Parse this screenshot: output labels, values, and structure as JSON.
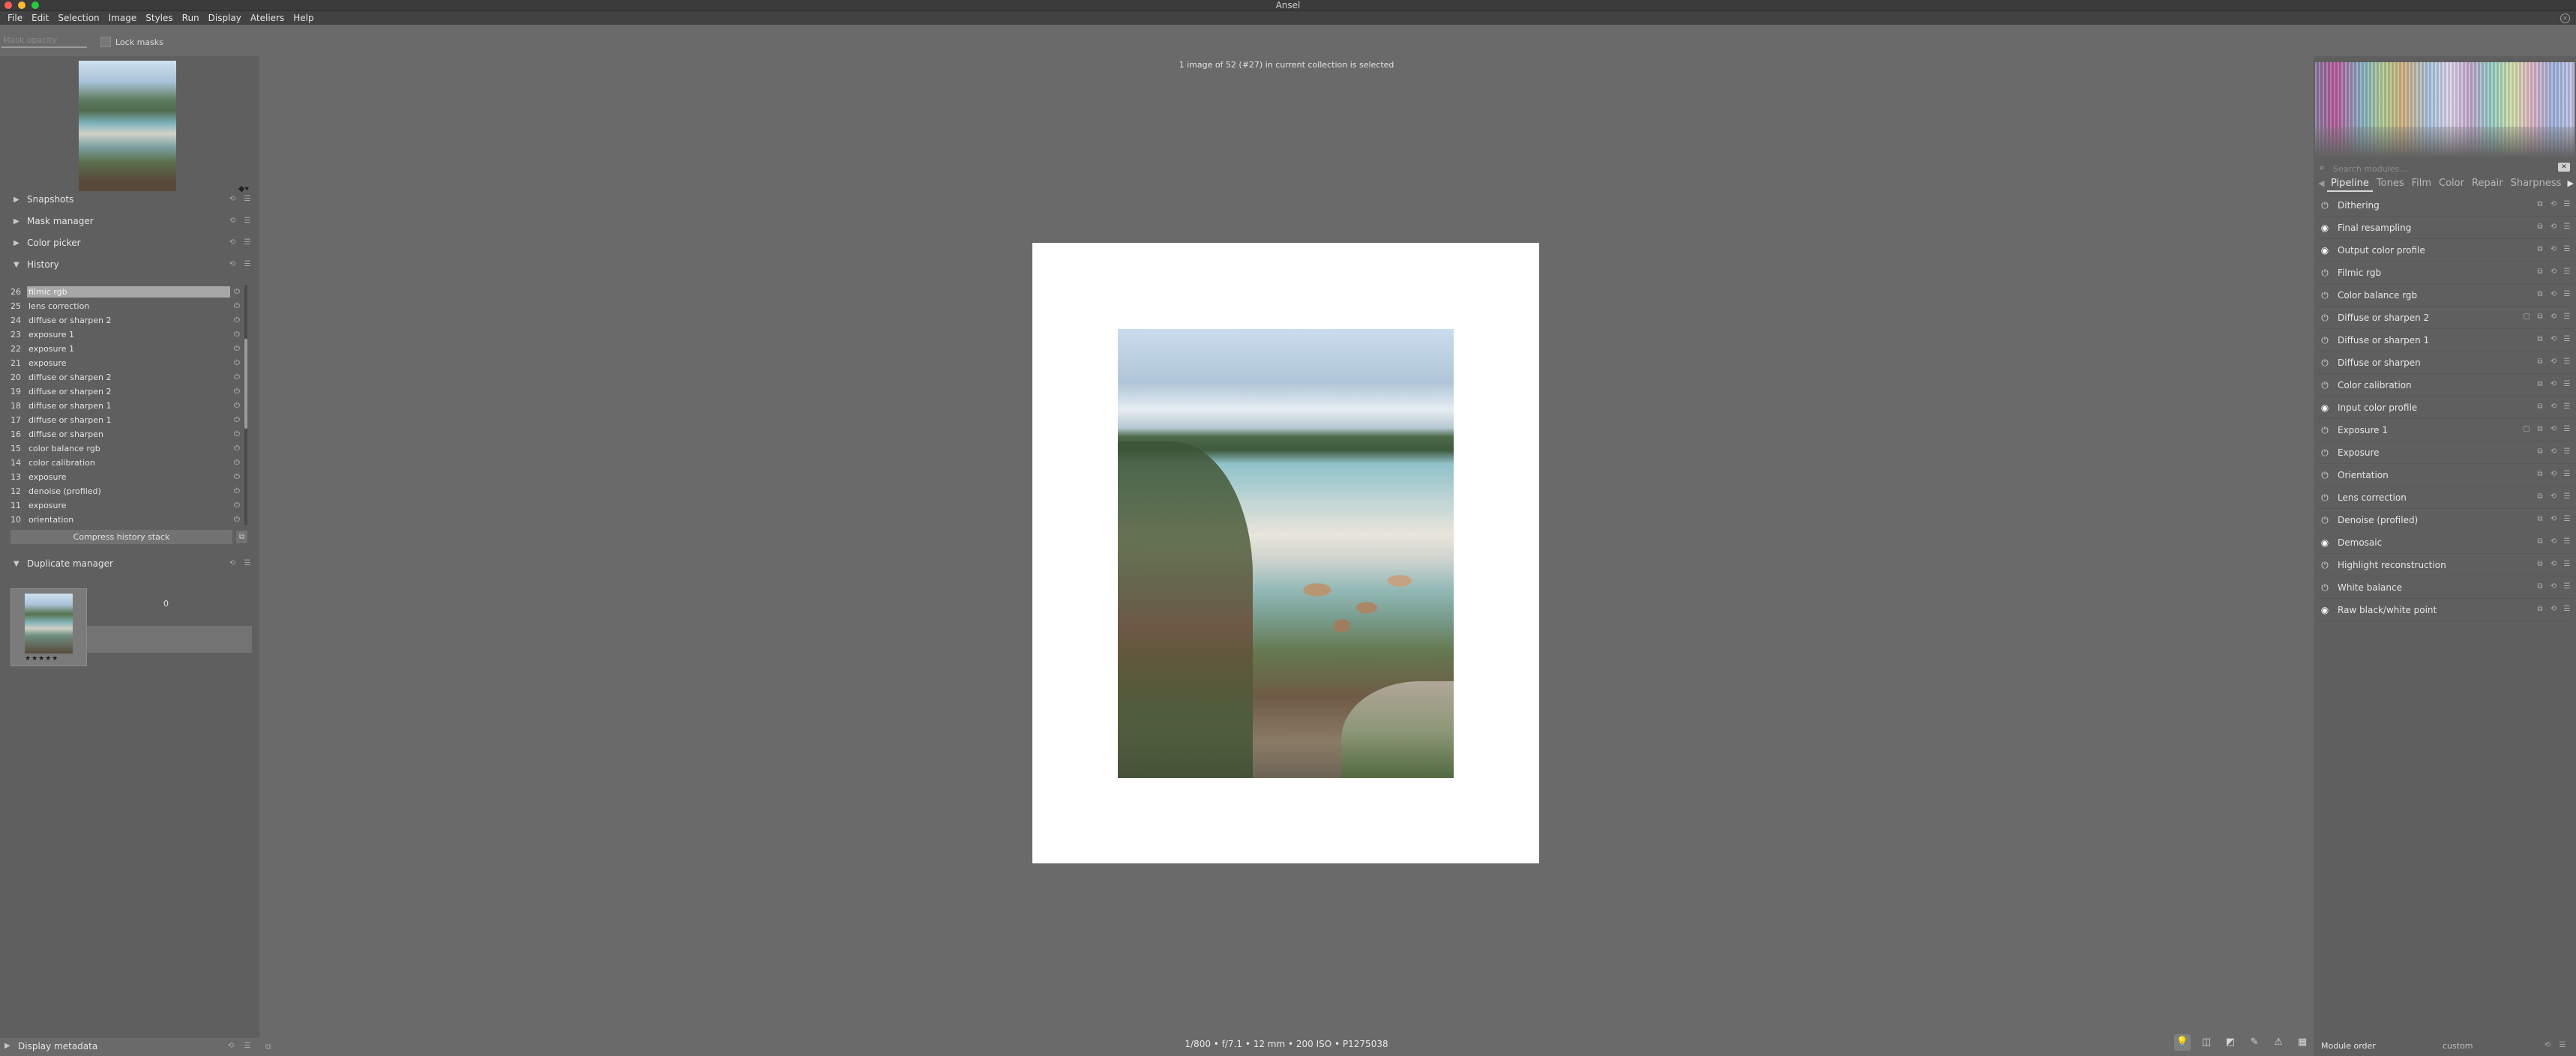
{
  "window": {
    "title": "Ansel"
  },
  "menu": [
    "File",
    "Edit",
    "Selection",
    "Image",
    "Styles",
    "Run",
    "Display",
    "Ateliers",
    "Help"
  ],
  "toolbar": {
    "mask_opacity_placeholder": "Mask opacity",
    "lock_masks_label": "Lock masks"
  },
  "left_panel": {
    "modules": {
      "snapshots": "Snapshots",
      "mask_manager": "Mask manager",
      "color_picker": "Color picker",
      "history": "History",
      "duplicate_manager": "Duplicate manager"
    },
    "history": [
      {
        "num": "26",
        "name": "filmic rgb",
        "selected": true
      },
      {
        "num": "25",
        "name": "lens correction"
      },
      {
        "num": "24",
        "name": "diffuse or sharpen 2"
      },
      {
        "num": "23",
        "name": "exposure 1"
      },
      {
        "num": "22",
        "name": "exposure 1"
      },
      {
        "num": "21",
        "name": "exposure"
      },
      {
        "num": "20",
        "name": "diffuse or sharpen 2"
      },
      {
        "num": "19",
        "name": "diffuse or sharpen 2"
      },
      {
        "num": "18",
        "name": "diffuse or sharpen 1"
      },
      {
        "num": "17",
        "name": "diffuse or sharpen 1"
      },
      {
        "num": "16",
        "name": "diffuse or sharpen"
      },
      {
        "num": "15",
        "name": "color balance rgb"
      },
      {
        "num": "14",
        "name": "color calibration"
      },
      {
        "num": "13",
        "name": "exposure"
      },
      {
        "num": "12",
        "name": "denoise (profiled)"
      },
      {
        "num": "11",
        "name": "exposure"
      },
      {
        "num": "10",
        "name": "orientation"
      }
    ],
    "compress_history_label": "Compress history stack",
    "duplicate": {
      "version": "0",
      "stars": "★★★★★"
    },
    "bottom_module": "Display metadata"
  },
  "center": {
    "status": "1 image of 52 (#27) in current collection is selected",
    "image_info": "1/800 • f/7.1 • 12 mm • 200 ISO • P1275038"
  },
  "right_panel": {
    "search_placeholder": "Search modules...",
    "tabs": [
      "Pipeline",
      "Tones",
      "Film",
      "Color",
      "Repair",
      "Sharpness"
    ],
    "active_tab": "Pipeline",
    "modules": [
      {
        "name": "Dithering",
        "on": false
      },
      {
        "name": "Final resampling",
        "on": true
      },
      {
        "name": "Output color profile",
        "on": true
      },
      {
        "name": "Filmic rgb",
        "on": false
      },
      {
        "name": "Color balance rgb",
        "on": false
      },
      {
        "name": "Diffuse or sharpen 2",
        "on": false,
        "masked": true
      },
      {
        "name": "Diffuse or sharpen 1",
        "on": false
      },
      {
        "name": "Diffuse or sharpen",
        "on": false
      },
      {
        "name": "Color calibration",
        "on": false
      },
      {
        "name": "Input color profile",
        "on": true
      },
      {
        "name": "Exposure 1",
        "on": false,
        "masked": true
      },
      {
        "name": "Exposure",
        "on": false
      },
      {
        "name": "Orientation",
        "on": false
      },
      {
        "name": "Lens correction",
        "on": false
      },
      {
        "name": "Denoise (profiled)",
        "on": false
      },
      {
        "name": "Demosaic",
        "on": true
      },
      {
        "name": "Highlight reconstruction",
        "on": false
      },
      {
        "name": "White balance",
        "on": false
      },
      {
        "name": "Raw black/white point",
        "on": true
      }
    ],
    "module_order_label": "Module order",
    "module_order_value": "custom"
  },
  "icons": {
    "power": "power-icon",
    "reset": "reset-icon",
    "presets": "presets-icon",
    "instance": "multi-instance-icon",
    "mask": "mask-icon"
  }
}
